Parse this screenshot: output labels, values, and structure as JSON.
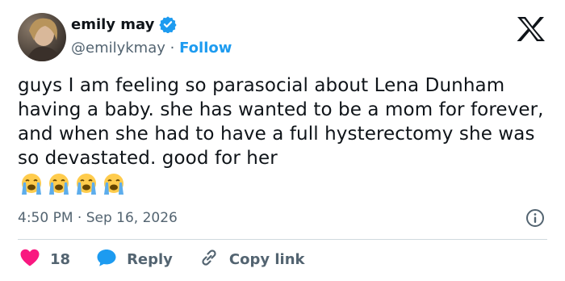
{
  "author": {
    "display_name": "emily may",
    "handle": "@emilykmay",
    "separator": "·",
    "follow_label": "Follow"
  },
  "tweet": {
    "text": "guys I am feeling so parasocial about Lena Dunham having a baby. she has wanted to be a mom for forever, and when she had to have a full hysterectomy she was so devastated. good for her",
    "emoji_count": 4,
    "emoji_name": "loudly-crying-face",
    "timestamp": "4:50 PM · Sep 16, 2026"
  },
  "actions": {
    "like_count": "18",
    "reply_label": "Reply",
    "copy_link_label": "Copy link"
  },
  "colors": {
    "accent": "#1d9bf0",
    "like": "#f91880",
    "secondary_text": "#536471",
    "divider": "#cfd9de"
  }
}
